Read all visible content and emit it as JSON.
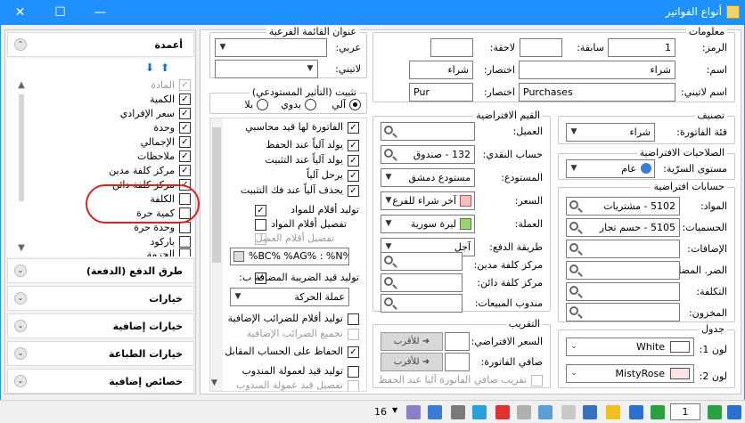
{
  "window": {
    "title": "أنواع الفواتير"
  },
  "info": {
    "title": "معلومات",
    "code_label": "الرمز:",
    "code_value": "1",
    "prefix_label": "سابقة:",
    "prefix_value": "",
    "suffix_label": "لاحقة:",
    "suffix_value": "",
    "name_label": "اسم:",
    "name_value": "شراء",
    "abbr_label": "اختصار:",
    "abbr_value": "شراء",
    "latin_name_label": "اسم لاتيني:",
    "latin_name_value": "Purchases",
    "latin_abbr_label": "اختصار:",
    "latin_abbr_value": "Pur"
  },
  "subtitle": {
    "title": "عنوان القائمة الفرعية",
    "arabic_label": "عربي:",
    "latin_label": "لاتيني:"
  },
  "classification": {
    "title": "تصنيف",
    "category_label": "فئة الفاتورة:",
    "category_value": "شراء"
  },
  "permissions": {
    "title": "الصلاحيات الافتراضية",
    "security_label": "مستوى السرّية:",
    "security_value": "عام"
  },
  "default_values": {
    "title": "القيم الافتراضية",
    "customer_label": "العميل:",
    "customer_value": "",
    "cash_account_label": "حساب النقدي:",
    "cash_account_value": "132 - صندوق",
    "warehouse_label": "المستودع:",
    "warehouse_value": "مستودع دمشق",
    "price_label": "السعر:",
    "price_value": "آخر شراء للفرع",
    "currency_label": "العملة:",
    "currency_value": "ليرة سورية",
    "payment_label": "طريقة الدفع:",
    "payment_value": "آجل",
    "debit_cc_label": "مركز كلفة مدين:",
    "debit_cc_value": "",
    "credit_cc_label": "مركز كلفة دائن:",
    "credit_cc_value": "",
    "sales_rep_label": "مندوب المبيعات:",
    "sales_rep_value": ""
  },
  "default_accounts": {
    "title": "حسابات افتراضية",
    "materials_label": "المواد:",
    "materials_value": "5102 - مشتريات",
    "discounts_label": "الحسميات:",
    "discounts_value": "5105 - حسم تجار",
    "additions_label": "الإضافات:",
    "additions_value": "",
    "additions_cost_label": "الضر. المضافة:",
    "additions_cost_value": "",
    "cost_label": "التكلفة:",
    "cost_value": "",
    "inventory_label": "المخزون:",
    "inventory_value": ""
  },
  "rounding": {
    "title": "التقريب",
    "default_price_label": "السعر الافتراضي:",
    "default_price_value": "للأقرب",
    "invoice_net_label": "صافي الفاتورة:",
    "invoice_net_value": "للأقرب",
    "auto_round_label": "تقريب صافي الفاتورة آليا عند الحفظ"
  },
  "table": {
    "title": "جدول",
    "color1_label": "لون 1:",
    "color1_value": "White",
    "color1_hex": "#ffffff",
    "color2_label": "لون 2:",
    "color2_value": "MistyRose",
    "color2_hex": "#ffe4e1"
  },
  "posting": {
    "title": "تثبيت (التأثير المستودعي)",
    "auto_label": "آلي",
    "manual_label": "يدوي",
    "none_label": "بلا",
    "options": [
      {
        "label": "الفاتورة لها قيد محاسبي",
        "checked": true
      },
      {
        "label": "يولد آلياً عند الحفظ",
        "checked": true
      },
      {
        "label": "يولد آلياً عند التثبيت",
        "checked": true
      },
      {
        "label": "يرحل آلياً",
        "checked": true
      },
      {
        "label": "يحذف آلياً عند فك التثبيت",
        "checked": true
      },
      {
        "label": "توليد أقلام للمواد",
        "checked": true
      },
      {
        "label": "تفصيل أقلام المواد",
        "checked": false
      },
      {
        "label": "تفصيل أقلام العميل",
        "checked": false
      },
      {
        "label": "توليد قيد الضريبة المضافة ب:",
        "checked": true
      },
      {
        "label": "توليد أقلام للضرائب الإضافية",
        "checked": false
      },
      {
        "label": "تجميع الضرائب الإضافية",
        "checked": false
      },
      {
        "label": "الحفاظ على الحساب المقابل",
        "checked": true
      },
      {
        "label": "توليد قيد لعمولة المندوب",
        "checked": false
      },
      {
        "label": "تفصيل قيد عمولة المندوب",
        "checked": false
      }
    ],
    "format_value": "%BC% %AG% : %N%",
    "tax_currency_value": "عملة الحركة"
  },
  "sidebar": {
    "columns_title": "أعمدة",
    "items": [
      {
        "label": "المادة",
        "checked": true,
        "disabled": true
      },
      {
        "label": "الكمية",
        "checked": true
      },
      {
        "label": "سعر الإفرادي",
        "checked": true
      },
      {
        "label": "وحدة",
        "checked": true
      },
      {
        "label": "الإجمالي",
        "checked": true
      },
      {
        "label": "ملاحظات",
        "checked": true
      },
      {
        "label": "مركز كلفة مدين",
        "checked": true
      },
      {
        "label": "مركز كلفة دائن",
        "checked": true
      },
      {
        "label": "الكلفة",
        "checked": false
      },
      {
        "label": "كمية حرة",
        "checked": false
      },
      {
        "label": "وحدة حرة",
        "checked": false
      },
      {
        "label": "باركود",
        "checked": false
      },
      {
        "label": "الحزمة",
        "checked": false
      }
    ],
    "sections": [
      {
        "label": "طرق الدفع (الدفعة)"
      },
      {
        "label": "خيارات"
      },
      {
        "label": "خيارات إضافية"
      },
      {
        "label": "خيارات الطباعة"
      },
      {
        "label": "خصائص إضافية"
      }
    ]
  },
  "toolbar": {
    "count": "16",
    "page": "1"
  },
  "colors": {
    "accent": "#1e90ff",
    "highlight": "#e02020"
  }
}
